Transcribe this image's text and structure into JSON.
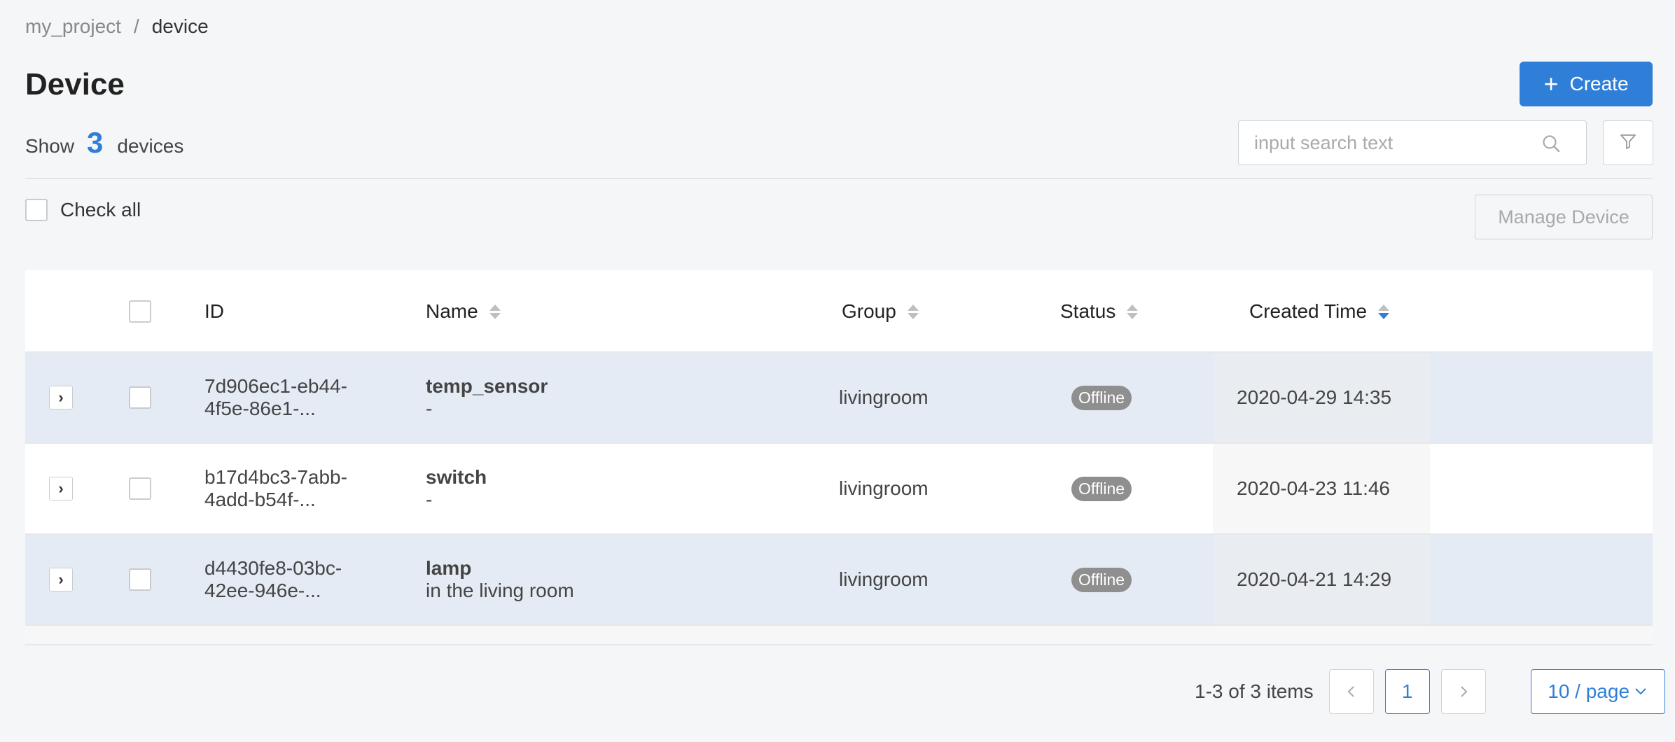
{
  "breadcrumb": {
    "project": "my_project",
    "separator": "/",
    "current": "device"
  },
  "header": {
    "title": "Device",
    "create_label": "Create"
  },
  "summary": {
    "prefix": "Show",
    "count": "3",
    "suffix": "devices"
  },
  "search": {
    "placeholder": "input search text"
  },
  "toolbar": {
    "check_all_label": "Check all",
    "manage_label": "Manage Device"
  },
  "table": {
    "columns": {
      "id": "ID",
      "name": "Name",
      "group": "Group",
      "status": "Status",
      "created": "Created Time"
    },
    "rows": [
      {
        "id_line1": "7d906ec1-eb44-",
        "id_line2": "4f5e-86e1-...",
        "name": "temp_sensor",
        "description": "-",
        "group": "livingroom",
        "status": "Offline",
        "created": "2020-04-29 14:35"
      },
      {
        "id_line1": "b17d4bc3-7abb-",
        "id_line2": "4add-b54f-...",
        "name": "switch",
        "description": "-",
        "group": "livingroom",
        "status": "Offline",
        "created": "2020-04-23 11:46"
      },
      {
        "id_line1": "d4430fe8-03bc-",
        "id_line2": "42ee-946e-...",
        "name": "lamp",
        "description": "in the living room",
        "group": "livingroom",
        "status": "Offline",
        "created": "2020-04-21 14:29"
      }
    ]
  },
  "pagination": {
    "total_text": "1-3 of 3 items",
    "current_page": "1",
    "page_size": "10 / page"
  },
  "colors": {
    "accent": "#2f7fd8",
    "status_offline": "#8f8f8f"
  },
  "icons": {
    "create": "plus-icon",
    "search": "search-icon",
    "filter": "filter-icon",
    "expand": "chevron-right-icon",
    "prev": "chevron-left-icon",
    "next": "chevron-right-icon",
    "page_size": "chevron-down-icon"
  }
}
